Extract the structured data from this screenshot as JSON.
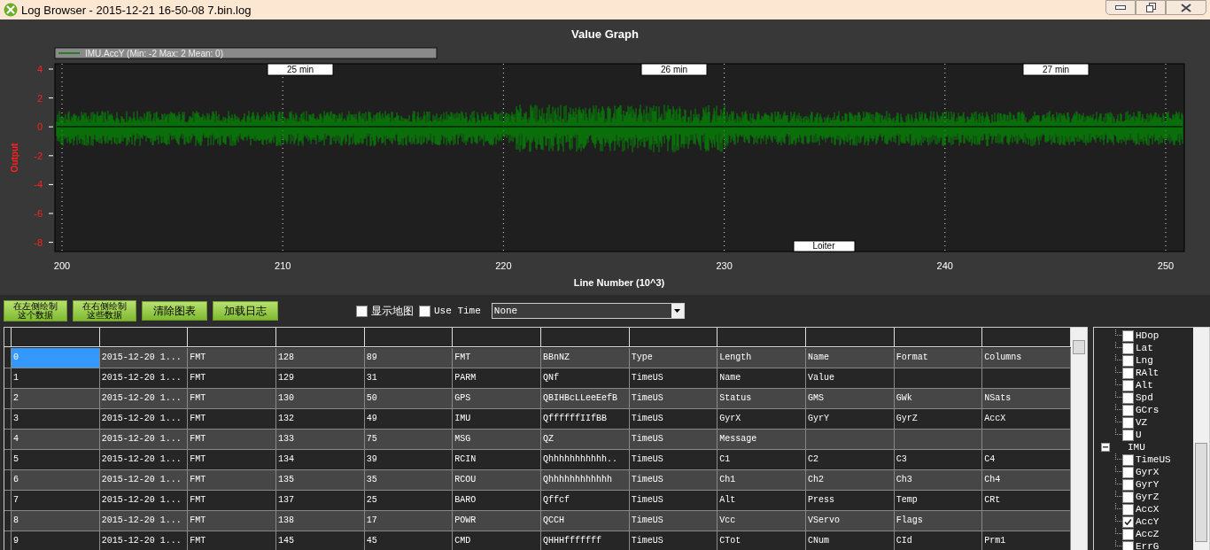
{
  "window": {
    "title": "Log Browser - 2015-12-21 16-50-08 7.bin.log"
  },
  "graph": {
    "title": "Value Graph",
    "legend": "IMU.AccY (Min: -2 Max: 2 Mean: 0)",
    "ylabel": "Output",
    "xlabel": "Line Number (10^3)",
    "yticks": [
      "4",
      "2",
      "0",
      "-2",
      "-4",
      "-6",
      "-8"
    ],
    "xticks": [
      "200",
      "210",
      "220",
      "230",
      "240",
      "250"
    ],
    "time_markers": [
      "25 min",
      "26 min",
      "27 min"
    ],
    "mode_markers": [
      "Loiter"
    ]
  },
  "toolbar": {
    "buttons": [
      "在左侧绘制这个数据",
      "在右侧绘制这些数据",
      "清除图表",
      "加载日志"
    ],
    "checkboxes": [
      {
        "label": "显示地图",
        "checked": false
      },
      {
        "label": "Use Time",
        "checked": false
      }
    ],
    "dropdown": {
      "value": "None"
    }
  },
  "table": {
    "rows": [
      {
        "selected": true,
        "cells": [
          "0",
          "2015-12-20 1...",
          "FMT",
          "128",
          "89",
          "FMT",
          "BBnNZ",
          "Type",
          "Length",
          "Name",
          "Format",
          "Columns"
        ]
      },
      {
        "selected": false,
        "cells": [
          "1",
          "2015-12-20 1...",
          "FMT",
          "129",
          "31",
          "PARM",
          "QNf",
          "TimeUS",
          "Name",
          "Value",
          "",
          ""
        ]
      },
      {
        "selected": false,
        "cells": [
          "2",
          "2015-12-20 1...",
          "FMT",
          "130",
          "50",
          "GPS",
          "QBIHBcLLeeEefB",
          "TimeUS",
          "Status",
          "GMS",
          "GWk",
          "NSats"
        ]
      },
      {
        "selected": false,
        "cells": [
          "3",
          "2015-12-20 1...",
          "FMT",
          "132",
          "49",
          "IMU",
          "QffffffIIfBB",
          "TimeUS",
          "GyrX",
          "GyrY",
          "GyrZ",
          "AccX"
        ]
      },
      {
        "selected": false,
        "cells": [
          "4",
          "2015-12-20 1...",
          "FMT",
          "133",
          "75",
          "MSG",
          "QZ",
          "TimeUS",
          "Message",
          "",
          "",
          ""
        ]
      },
      {
        "selected": false,
        "cells": [
          "5",
          "2015-12-20 1...",
          "FMT",
          "134",
          "39",
          "RCIN",
          "Qhhhhhhhhhhh..",
          "TimeUS",
          "C1",
          "C2",
          "C3",
          "C4"
        ]
      },
      {
        "selected": false,
        "cells": [
          "6",
          "2015-12-20 1...",
          "FMT",
          "135",
          "35",
          "RCOU",
          "Qhhhhhhhhhhhh",
          "TimeUS",
          "Ch1",
          "Ch2",
          "Ch3",
          "Ch4"
        ]
      },
      {
        "selected": false,
        "cells": [
          "7",
          "2015-12-20 1...",
          "FMT",
          "137",
          "25",
          "BARO",
          "Qffcf",
          "TimeUS",
          "Alt",
          "Press",
          "Temp",
          "CRt"
        ]
      },
      {
        "selected": false,
        "cells": [
          "8",
          "2015-12-20 1...",
          "FMT",
          "138",
          "17",
          "POWR",
          "QCCH",
          "TimeUS",
          "Vcc",
          "VServo",
          "Flags",
          ""
        ]
      },
      {
        "selected": false,
        "cells": [
          "9",
          "2015-12-20 1...",
          "FMT",
          "145",
          "45",
          "CMD",
          "QHHHfffffff",
          "TimeUS",
          "CTot",
          "CNum",
          "CId",
          "Prm1"
        ]
      }
    ]
  },
  "tree": [
    {
      "children": [
        {
          "label": "HDop",
          "checked": false
        },
        {
          "label": "Lat",
          "checked": false
        },
        {
          "label": "Lng",
          "checked": false
        },
        {
          "label": "RAlt",
          "checked": false
        },
        {
          "label": "Alt",
          "checked": false
        },
        {
          "label": "Spd",
          "checked": false
        },
        {
          "label": "GCrs",
          "checked": false
        },
        {
          "label": "VZ",
          "checked": false
        },
        {
          "label": "U",
          "checked": false
        }
      ]
    },
    {
      "label": "IMU",
      "expanded": true,
      "children": [
        {
          "label": "TimeUS",
          "checked": false
        },
        {
          "label": "GyrX",
          "checked": false
        },
        {
          "label": "GyrY",
          "checked": false
        },
        {
          "label": "GyrZ",
          "checked": false
        },
        {
          "label": "AccX",
          "checked": false
        },
        {
          "label": "AccY",
          "checked": true
        },
        {
          "label": "AccZ",
          "checked": false
        },
        {
          "label": "ErrG",
          "checked": false
        }
      ]
    }
  ]
}
